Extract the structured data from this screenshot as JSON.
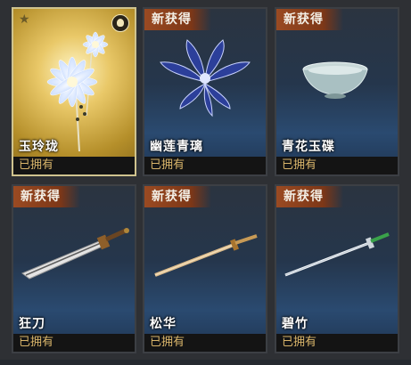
{
  "cards": [
    {
      "name": "玉玲珑",
      "badge": "",
      "status": "已拥有",
      "rarity": "legendary",
      "icon": "flower-icon"
    },
    {
      "name": "幽莲青璃",
      "badge": "新获得",
      "status": "已拥有",
      "icon": "blue-lotus-icon"
    },
    {
      "name": "青花玉碟",
      "badge": "新获得",
      "status": "已拥有",
      "icon": "porcelain-dish-icon"
    },
    {
      "name": "狂刀",
      "badge": "新获得",
      "status": "已拥有",
      "icon": "broad-sword-icon"
    },
    {
      "name": "松华",
      "badge": "新获得",
      "status": "已拥有",
      "icon": "wooden-sword-icon"
    },
    {
      "name": "碧竹",
      "badge": "新获得",
      "status": "已拥有",
      "icon": "jade-sword-icon"
    }
  ],
  "colors": {
    "badge": "#9a4a22",
    "owned_text": "#d8b46a",
    "gold_frame": "#cfc38e"
  }
}
